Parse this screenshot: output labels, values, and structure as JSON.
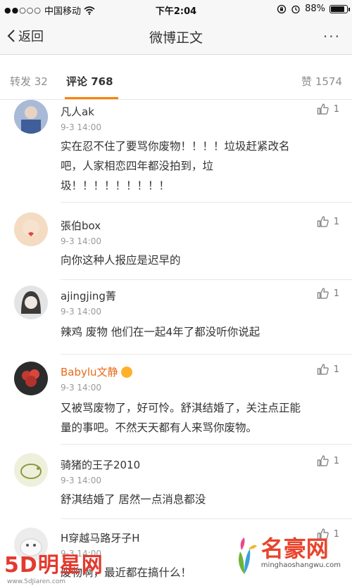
{
  "status_bar": {
    "signal_dots": "●●○○○",
    "carrier": "中国移动",
    "time": "下午2:04",
    "battery": "88%",
    "battery_level": 0.88,
    "icons": [
      "wifi-icon",
      "lock-rotation-icon",
      "alarm-icon",
      "battery-icon"
    ]
  },
  "nav": {
    "back_label": "返回",
    "title": "微博正文",
    "more_label": "···"
  },
  "tabs": {
    "reposts": "转发 32",
    "comments": "评论 768",
    "likes": "赞 1574",
    "active_color": "#ff8200"
  },
  "comments": [
    {
      "name": "凡人ak",
      "time": "9-3 14:00",
      "text_lines": [
        "实在忍不住了要骂你废物！！！！垃圾赶紧改名",
        "吧，人家相恋四年都没拍到，垃",
        "圾！！！！！！！！！"
      ],
      "likes": "1",
      "avatar_color": "#8aa3c8"
    },
    {
      "name": "張伯box",
      "time": "9-3 14:00",
      "text_lines": [
        "向你这种人报应是迟早的"
      ],
      "likes": "1",
      "avatar_color": "#f0d6b8"
    },
    {
      "name": "ajingjing菁",
      "time": "9-3 14:00",
      "text_lines": [
        "辣鸡 废物 他们在一起4年了都没听你说起"
      ],
      "likes": "1",
      "avatar_color": "#cfcfcf"
    },
    {
      "name": "Babylu文静",
      "time": "9-3 14:00",
      "text_lines": [
        "又被骂废物了，好可怜。舒淇结婚了，关注点正能",
        "量的事吧。不然天天都有人来骂你废物。"
      ],
      "likes": "1",
      "avatar_color": "#b43a36",
      "vip": true
    },
    {
      "name": "骑猪的王子2010",
      "time": "9-3 14:00",
      "text_lines": [
        "舒淇结婚了 居然一点消息都没"
      ],
      "likes": "1",
      "avatar_color": "#dfe6c5"
    },
    {
      "name": "H穿越马路牙子H",
      "time": "9-3 14:00",
      "text_lines": [
        "废物啊，最近都在搞什么！"
      ],
      "likes": "1",
      "avatar_color": "#e6e6e6"
    }
  ],
  "watermarks": {
    "left_big": "5D明星网",
    "left_small": "www.5dJiaren.com",
    "right_big": "名豪网",
    "right_small": "minghaoshangwu.com"
  }
}
